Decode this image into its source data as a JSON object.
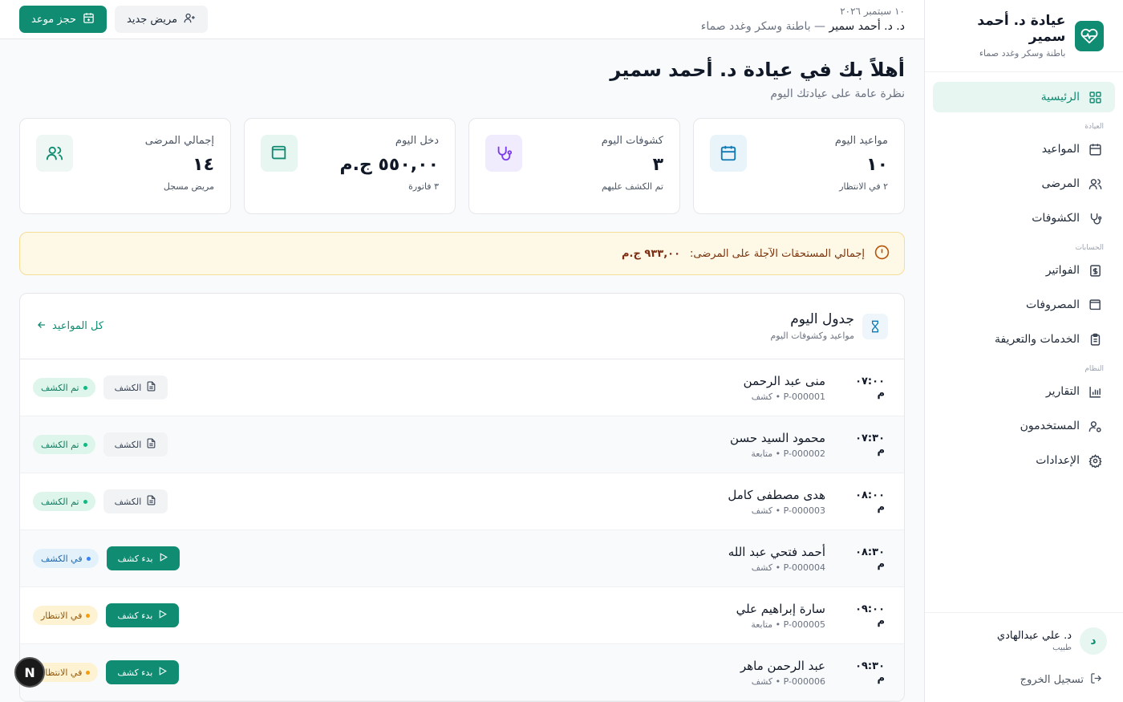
{
  "brand": {
    "title": "عيادة د. أحمد سمير",
    "subtitle": "باطنة وسكر وغدد صماء"
  },
  "nav": {
    "home": "الرئيسية",
    "section_clinic": "العيادة",
    "appointments": "المواعيد",
    "patients": "المرضى",
    "exams": "الكشوفات",
    "section_accounts": "الحسابات",
    "invoices": "الفواتير",
    "expenses": "المصروفات",
    "services": "الخدمات والتعريفة",
    "section_system": "النظام",
    "reports": "التقارير",
    "users": "المستخدمون",
    "settings": "الإعدادات"
  },
  "user": {
    "initial": "د",
    "name": "د. علي عبدالهادي",
    "role": "طبيب",
    "logout": "تسجيل الخروج"
  },
  "topbar": {
    "date": "١٠ سبتمبر ٢٠٢٦",
    "doctor": "د. د. أحمد سمير",
    "specialty": "— باطنة وسكر وغدد صماء",
    "book_label": "حجز موعد",
    "new_patient_label": "مريض جديد"
  },
  "welcome": {
    "title": "أهلاً بك في عيادة د. أحمد سمير",
    "subtitle": "نظرة عامة على عيادتك اليوم"
  },
  "stats": [
    {
      "label": "مواعيد اليوم",
      "value": "١٠",
      "note": "٢ في الانتظار",
      "icon": "calendar-icon",
      "color": "#0e7ab5",
      "bg": "#e8f3fa"
    },
    {
      "label": "كشوفات اليوم",
      "value": "٣",
      "note": "تم الكشف عليهم",
      "icon": "stethoscope-icon",
      "color": "#7c3aed",
      "bg": "#f1ecfd"
    },
    {
      "label": "دخل اليوم",
      "value": "٥٥٠,٠٠ ج.م",
      "note": "٣ فاتورة",
      "icon": "wallet-icon",
      "color": "#0f8c72",
      "bg": "#e7f6f1"
    },
    {
      "label": "إجمالي المرضى",
      "value": "١٤",
      "note": "مريض مسجل",
      "icon": "users-icon",
      "color": "#0f8c72",
      "bg": "#eef7f4"
    }
  ],
  "alert": {
    "text": "إجمالي المستحقات الآجلة على المرضى:",
    "amount": "٩٣٣,٠٠ ج.م"
  },
  "schedule": {
    "title": "جدول اليوم",
    "subtitle": "مواعيد وكشوفات اليوم",
    "all_link": "كل المواعيد",
    "rows": [
      {
        "time": "٠٧:٠٠ م",
        "name": "منى عبد الرحمن",
        "code": "P-000001",
        "type": "كشف",
        "status": "تم الكشف",
        "status_kind": "done",
        "action": "الكشف",
        "action_kind": "ghost"
      },
      {
        "time": "٠٧:٣٠ م",
        "name": "محمود السيد حسن",
        "code": "P-000002",
        "type": "متابعة",
        "status": "تم الكشف",
        "status_kind": "done",
        "action": "الكشف",
        "action_kind": "ghost"
      },
      {
        "time": "٠٨:٠٠ م",
        "name": "هدى مصطفى كامل",
        "code": "P-000003",
        "type": "كشف",
        "status": "تم الكشف",
        "status_kind": "done",
        "action": "الكشف",
        "action_kind": "ghost"
      },
      {
        "time": "٠٨:٣٠ م",
        "name": "أحمد فتحي عبد الله",
        "code": "P-000004",
        "type": "كشف",
        "status": "في الكشف",
        "status_kind": "in",
        "action": "بدء كشف",
        "action_kind": "solid"
      },
      {
        "time": "٠٩:٠٠ م",
        "name": "سارة إبراهيم علي",
        "code": "P-000005",
        "type": "متابعة",
        "status": "في الانتظار",
        "status_kind": "wait",
        "action": "بدء كشف",
        "action_kind": "solid"
      },
      {
        "time": "٠٩:٣٠ م",
        "name": "عبد الرحمن ماهر",
        "code": "P-000006",
        "type": "كشف",
        "status": "في الانتظار",
        "status_kind": "wait",
        "action": "بدء كشف",
        "action_kind": "solid"
      }
    ]
  },
  "floating": {
    "label": "N"
  },
  "colors": {
    "accent": "#0f8c72",
    "background": "#f8fafb"
  }
}
